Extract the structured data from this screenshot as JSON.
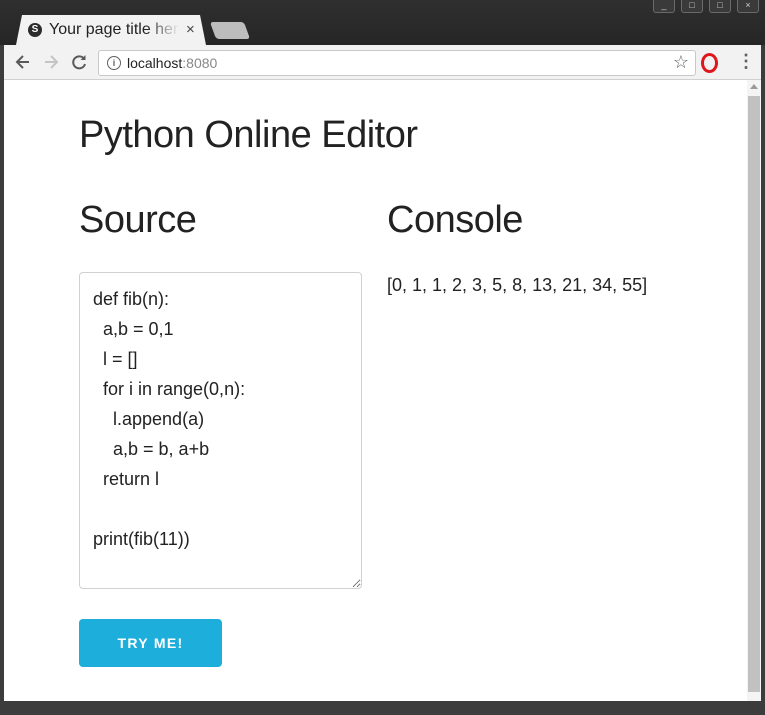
{
  "browser": {
    "tab_title": "Your page title here",
    "tab_favicon_letter": "S",
    "tab_close": "×",
    "url_host": "localhost",
    "url_port": ":8080",
    "window_controls": [
      "_",
      "□",
      "□",
      "×"
    ]
  },
  "page": {
    "title": "Python Online Editor",
    "source_heading": "Source",
    "console_heading": "Console",
    "source_code": "def fib(n):\n  a,b = 0,1\n  l = []\n  for i in range(0,n):\n    l.append(a)\n    a,b = b, a+b\n  return l\n\nprint(fib(11))",
    "console_output": "[0, 1, 1, 2, 3, 5, 8, 13, 21, 34, 55]",
    "run_button_label": "TRY ME!"
  },
  "colors": {
    "button_accent": "#1eaedb",
    "opera_red": "#e0171a"
  }
}
